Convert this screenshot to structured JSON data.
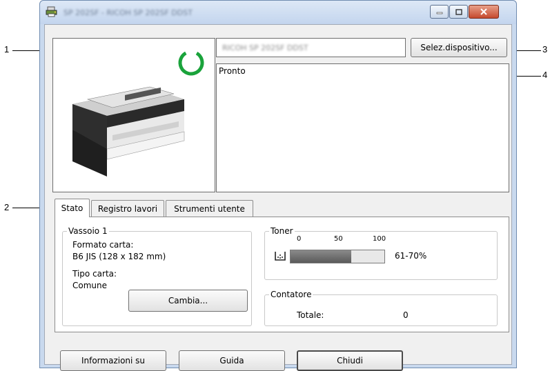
{
  "window": {
    "title": "SP 202SF - RICOH SP 202SF DDST",
    "controls": {
      "minimize": "minimize",
      "maximize": "maximize",
      "close": "close"
    }
  },
  "device": {
    "name": "RICOH SP 202SF DDST",
    "select_button": "Selez.dispositivo...",
    "status": "Pronto",
    "status_color": "#1aa33b"
  },
  "tabs": [
    {
      "label": "Stato",
      "active": true
    },
    {
      "label": "Registro lavori",
      "active": false
    },
    {
      "label": "Strumenti utente",
      "active": false
    }
  ],
  "tray": {
    "legend": "Vassoio 1",
    "paper_size_label": "Formato carta:",
    "paper_size_value": "B6 JIS (128 x 182 mm)",
    "paper_type_label": "Tipo carta:",
    "paper_type_value": "Comune",
    "change_button": "Cambia..."
  },
  "toner": {
    "legend": "Toner",
    "scale": [
      "0",
      "50",
      "100"
    ],
    "level": 0.65,
    "level_text": "61-70%",
    "icon": "toner-cartridge-icon"
  },
  "counter": {
    "legend": "Contatore",
    "total_label": "Totale:",
    "total_value": "0"
  },
  "buttons": {
    "info": "Informazioni su",
    "help": "Guida",
    "close": "Chiudi"
  },
  "callouts": [
    "1",
    "2",
    "3",
    "4"
  ]
}
